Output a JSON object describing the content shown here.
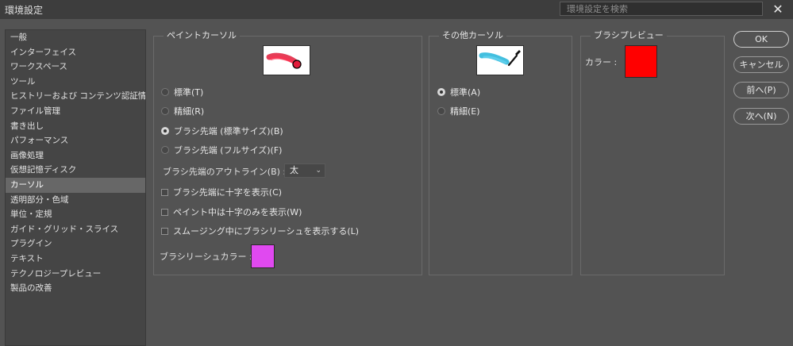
{
  "window": {
    "title": "環境設定",
    "close_glyph": "✕"
  },
  "search": {
    "placeholder": "環境設定を検索"
  },
  "sidebar": {
    "items": [
      {
        "label": "一般"
      },
      {
        "label": "インターフェイス"
      },
      {
        "label": "ワークスペース"
      },
      {
        "label": "ツール"
      },
      {
        "label": "ヒストリーおよび コンテンツ認証情報"
      },
      {
        "label": "ファイル管理"
      },
      {
        "label": "書き出し"
      },
      {
        "label": "パフォーマンス"
      },
      {
        "label": "画像処理"
      },
      {
        "label": "仮想記憶ディスク"
      },
      {
        "label": "カーソル"
      },
      {
        "label": "透明部分・色域"
      },
      {
        "label": "単位・定規"
      },
      {
        "label": "ガイド・グリッド・スライス"
      },
      {
        "label": "プラグイン"
      },
      {
        "label": "テキスト"
      },
      {
        "label": "テクノロジープレビュー"
      },
      {
        "label": "製品の改善"
      }
    ],
    "selected": "カーソル"
  },
  "paint_cursors": {
    "title": "ペイントカーソル",
    "options": [
      {
        "label": "標準(T)",
        "checked": false
      },
      {
        "label": "精細(R)",
        "checked": false
      },
      {
        "label": "ブラシ先端 (標準サイズ)(B)",
        "checked": true
      },
      {
        "label": "ブラシ先端 (フルサイズ)(F)",
        "checked": false
      }
    ],
    "outline_label": "ブラシ先端のアウトライン(B) :",
    "outline_value": "太",
    "checkboxes": [
      {
        "label": "ブラシ先端に十字を表示(C)",
        "checked": false
      },
      {
        "label": "ペイント中は十字のみを表示(W)",
        "checked": false
      },
      {
        "label": "スムージング中にブラシリーシュを表示する(L)",
        "checked": false
      }
    ],
    "leash_label": "ブラシリーシュカラー :",
    "leash_color": "#e049f0"
  },
  "other_cursors": {
    "title": "その他カーソル",
    "options": [
      {
        "label": "標準(A)",
        "checked": true
      },
      {
        "label": "精細(E)",
        "checked": false
      }
    ]
  },
  "brush_preview": {
    "title": "ブラシプレビュー",
    "color_label": "カラー :",
    "color": "#ff0000"
  },
  "buttons": {
    "ok": "OK",
    "cancel": "キャンセル",
    "prev": "前へ(P)",
    "next": "次へ(N)"
  },
  "colors": {
    "paint_stroke": "#e11b3a",
    "other_stroke": "#2fb8dc"
  }
}
